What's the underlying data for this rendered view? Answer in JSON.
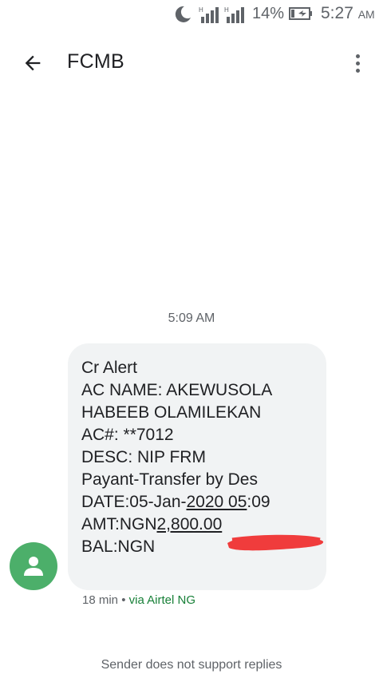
{
  "status_bar": {
    "battery_percent": "14%",
    "time": "5:27",
    "ampm": "AM",
    "icons": [
      "do-not-disturb-moon-icon",
      "signal-icon",
      "signal-icon",
      "battery-charging-icon"
    ]
  },
  "app_bar": {
    "title": "FCMB",
    "back_icon": "arrow-back-icon",
    "more_icon": "more-vert-icon"
  },
  "conversation": {
    "timestamp": "5:09 AM",
    "message": {
      "line1": "Cr Alert",
      "line2": "AC NAME: AKEWUSOLA",
      "line3": "HABEEB OLAMILEKAN",
      "line4": "AC#: **7012",
      "line5": "DESC: NIP FRM",
      "line6": "Payant-Transfer by Des",
      "line7_prefix": "DATE:05-Jan-",
      "line7_underlined": "2020 05",
      "line7_suffix": ":09",
      "line8_prefix": "AMT:NGN",
      "line8_underlined": "2,800.00",
      "line9_prefix": "BAL:NGN"
    },
    "meta_age": "18 min",
    "meta_sep": " • ",
    "meta_via": "via Airtel NG",
    "footer": "Sender does not support replies"
  },
  "colors": {
    "avatar_bg": "#4caf6a",
    "bubble_bg": "#f1f3f4",
    "via_green": "#188038",
    "redaction_red": "#f03c3c"
  }
}
